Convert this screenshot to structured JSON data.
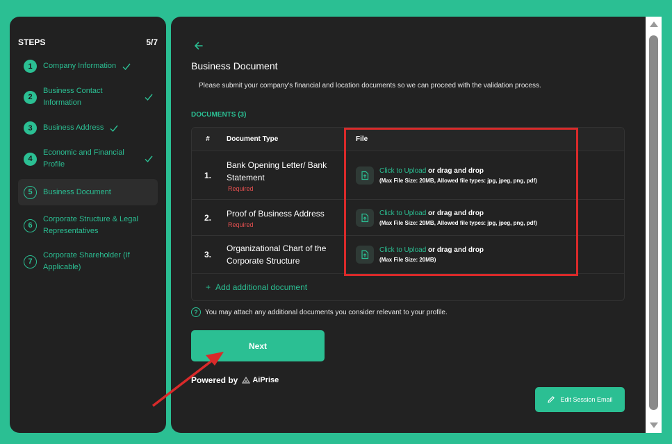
{
  "sidebar": {
    "title": "STEPS",
    "progress": "5/7",
    "steps": [
      {
        "num": "1",
        "label": "Company Information",
        "status": "done"
      },
      {
        "num": "2",
        "label": "Business Contact Information",
        "status": "done"
      },
      {
        "num": "3",
        "label": "Business Address",
        "status": "done"
      },
      {
        "num": "4",
        "label": "Economic and Financial Profile",
        "status": "done"
      },
      {
        "num": "5",
        "label": "Business Document",
        "status": "active"
      },
      {
        "num": "6",
        "label": "Corporate Structure & Legal Representatives",
        "status": "todo"
      },
      {
        "num": "7",
        "label": "Corporate Shareholder (If Applicable)",
        "status": "todo"
      }
    ]
  },
  "main": {
    "title": "Business Document",
    "subtitle": "Please submit your company's financial and location documents so we can proceed with the validation process.",
    "section_label": "DOCUMENTS (3)",
    "table": {
      "headers": [
        "#",
        "Document Type",
        "File"
      ],
      "rows": [
        {
          "num": "1.",
          "doc_type": "Bank Opening Letter/ Bank Statement",
          "required": "Required",
          "upload_link": "Click to Upload",
          "upload_text": " or drag and drop",
          "constraints": "(Max File Size: 20MB, Allowed file types: jpg, jpeg, png, pdf)"
        },
        {
          "num": "2.",
          "doc_type": "Proof of Business Address",
          "required": "Required",
          "upload_link": "Click to Upload",
          "upload_text": " or drag and drop",
          "constraints": "(Max File Size: 20MB, Allowed file types: jpg, jpeg, png, pdf)"
        },
        {
          "num": "3.",
          "doc_type": "Organizational Chart of the Corporate Structure",
          "required": "",
          "upload_link": "Click to Upload",
          "upload_text": " or drag and drop",
          "constraints": "(Max File Size: 20MB)"
        }
      ],
      "add_label": "Add additional document"
    },
    "hint": "You may attach any additional documents you consider relevant to your profile.",
    "next_label": "Next",
    "powered_by": "Powered by",
    "brand": "AiPrise",
    "edit_email_label": "Edit Session Email"
  },
  "colors": {
    "accent": "#2bbf93",
    "panel": "#212121",
    "required": "#e55050",
    "highlight": "#d92a2a"
  }
}
